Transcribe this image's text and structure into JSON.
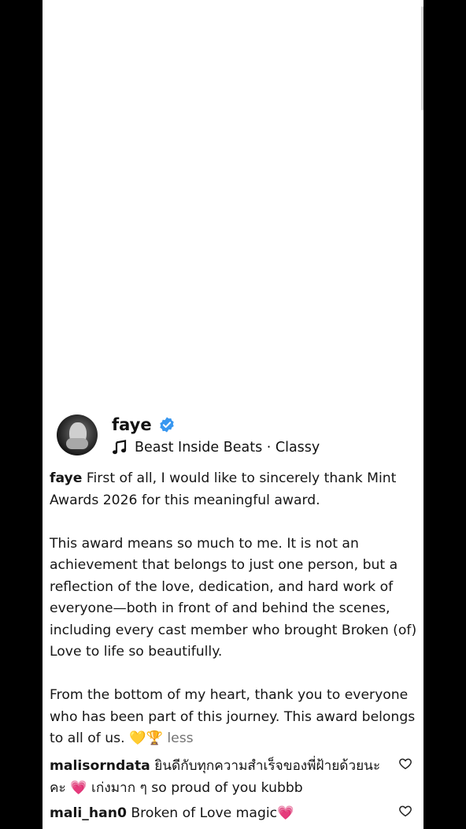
{
  "post": {
    "username": "faye",
    "verified": true,
    "audio_label": "Beast Inside Beats · Classy"
  },
  "caption": {
    "handle": "faye",
    "paragraph1": "First of all, I would like to sincerely thank Mint Awards 2026 for this meaningful award.",
    "paragraph2": "This award means so much to me. It is not an achievement that belongs to just one person, but a reflection of the love, dedication, and hard work of everyone—both in front of and behind the scenes, including every cast member who brought Broken (of) Love to life so beautifully.",
    "paragraph3": "From the bottom of my heart, thank you to everyone who has been part of this journey. This award belongs to all of us. 💛🏆",
    "more_label": "less"
  },
  "comments": [
    {
      "handle": "malisorndata",
      "text": "ยินดีกับทุกความสำเร็จของพี่ฝ้ายด้วยนะคะ 💗 เก่งมาก ๆ so proud of you kubbb"
    },
    {
      "handle": "mali_han0",
      "text": "Broken of Love magic💗"
    }
  ],
  "colors": {
    "verified_blue": "#3897f0",
    "background_outer": "#000000",
    "panel": "#ffffff",
    "muted_text": "#737373"
  },
  "icons": {
    "verified": "verified-badge-icon",
    "music": "music-note-icon",
    "like": "heart-outline-icon"
  }
}
